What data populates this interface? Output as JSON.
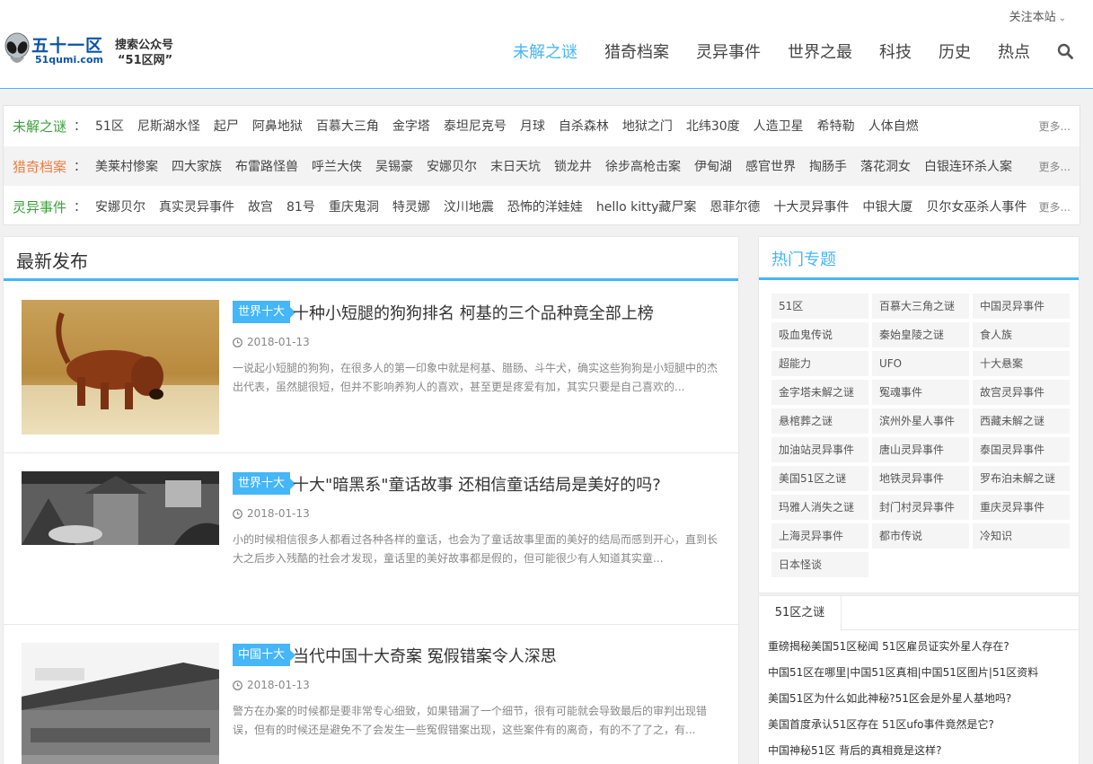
{
  "header": {
    "follow_label": "关注本站",
    "logo": {
      "main": "五十一区",
      "sub": "51qumi.com",
      "slogan_line1": "搜索公众号",
      "slogan_line2": "“51区网”"
    },
    "nav": [
      {
        "label": "未解之谜",
        "active": true
      },
      {
        "label": "猎奇档案",
        "active": false
      },
      {
        "label": "灵异事件",
        "active": false
      },
      {
        "label": "世界之最",
        "active": false
      },
      {
        "label": "科技",
        "active": false
      },
      {
        "label": "历史",
        "active": false
      },
      {
        "label": "热点",
        "active": false
      }
    ],
    "search_icon": "search-icon",
    "accent_color": "#45b6f7"
  },
  "tag_rows": [
    {
      "category": "未解之谜",
      "color": "#3aa03a",
      "more": "更多...",
      "tags": [
        "51区",
        "尼斯湖水怪",
        "起尸",
        "阿鼻地狱",
        "百慕大三角",
        "金字塔",
        "泰坦尼克号",
        "月球",
        "自杀森林",
        "地狱之门",
        "北纬30度",
        "人造卫星",
        "希特勒",
        "人体自燃"
      ]
    },
    {
      "category": "猎奇档案",
      "color": "#f07d46",
      "more": "更多...",
      "tags": [
        "美莱村惨案",
        "四大家族",
        "布雷路怪兽",
        "呼兰大侠",
        "吴锡豪",
        "安娜贝尔",
        "末日天坑",
        "锁龙井",
        "徐步高枪击案",
        "伊甸湖",
        "感官世界",
        "掏肠手",
        "落花洞女",
        "白银连环杀人案"
      ]
    },
    {
      "category": "灵异事件",
      "color": "#3aa03a",
      "more": "更多...",
      "tags": [
        "安娜贝尔",
        "真实灵异事件",
        "故宫",
        "81号",
        "重庆鬼洞",
        "特灵娜",
        "汶川地震",
        "恐怖的洋娃娃",
        "hello kitty藏尸案",
        "恩菲尔德",
        "十大灵异事件",
        "中银大厦",
        "贝尔女巫杀人事件"
      ]
    }
  ],
  "main": {
    "heading": "最新发布",
    "posts": [
      {
        "badge": "世界十大",
        "title": "十种小短腿的狗狗排名 柯基的三个品种竟全部上榜",
        "date": "2018-01-13",
        "excerpt": "一说起小短腿的狗狗，在很多人的第一印象中就是柯基、腊肠、斗牛犬，确实这些狗狗是小短腿中的杰出代表，虽然腿很短，但并不影响养狗人的喜欢，甚至更是疼爱有加，其实只要是自己喜欢的..."
      },
      {
        "badge": "世界十大",
        "title": "十大\"暗黑系\"童话故事 还相信童话结局是美好的吗?",
        "date": "2018-01-13",
        "excerpt": "小的时候相信很多人都看过各种各样的童话，也会为了童话故事里面的美好的结局而感到开心，直到长大之后步入残酷的社会才发现，童话里的美好故事都是假的，但可能很少有人知道其实童..."
      },
      {
        "badge": "中国十大",
        "title": "当代中国十大奇案 冤假错案令人深思",
        "date": "2018-01-13",
        "excerpt": "警方在办案的时候都是要非常专心细致，如果错漏了一个细节，很有可能就会导致最后的审判出现错误，但有的时候还是避免不了会发生一些冤假错案出现，这些案件有的离奇，有的不了了之，有..."
      }
    ]
  },
  "sidebar": {
    "hot_heading": "热门专题",
    "topics": [
      "51区",
      "百慕大三角之谜",
      "中国灵异事件",
      "吸血鬼传说",
      "秦始皇陵之谜",
      "食人族",
      "超能力",
      "UFO",
      "十大悬案",
      "金字塔未解之谜",
      "冤魂事件",
      "故宫灵异事件",
      "悬棺葬之谜",
      "滨州外星人事件",
      "西藏未解之谜",
      "加油站灵异事件",
      "唐山灵异事件",
      "泰国灵异事件",
      "美国51区之谜",
      "地铁灵异事件",
      "罗布泊未解之谜",
      "玛雅人消失之谜",
      "封门村灵异事件",
      "重庆灵异事件",
      "上海灵异事件",
      "都市传说",
      "冷知识",
      "日本怪谈"
    ],
    "tab_label": "51区之谜",
    "articles": [
      "重磅揭秘美国51区秘闻 51区雇员证实外星人存在?",
      "中国51区在哪里|中国51区真相|中国51区图片|51区资料",
      "美国51区为什么如此神秘?51区会是外星人基地吗?",
      "美国首度承认51区存在 51区ufo事件竟然是它?",
      "中国神秘51区 背后的真相竟是这样?"
    ]
  }
}
